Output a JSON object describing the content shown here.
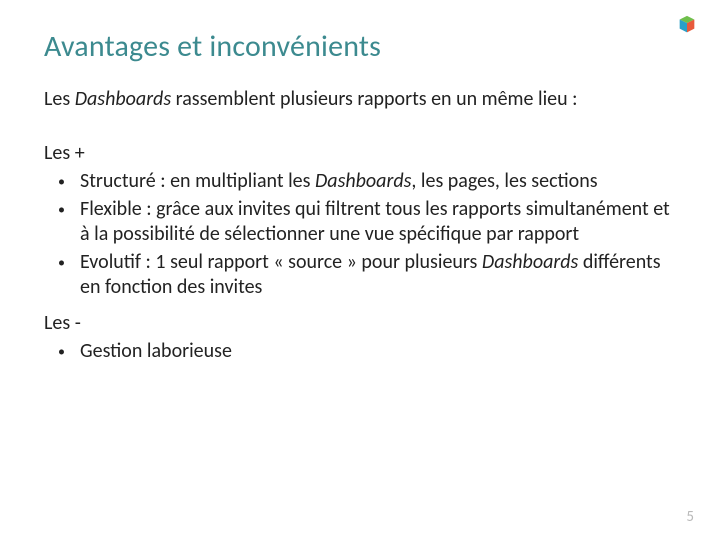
{
  "title": "Avantages et inconvénients",
  "lead_pre": "Les ",
  "lead_em": "Dashboards",
  "lead_post": " rassemblent plusieurs rapports en un même lieu :",
  "pros_label": "Les +",
  "pros": [
    {
      "html": "Structuré : en multipliant les <span class=\"term\">Dashboards</span>, les pages, les sections"
    },
    {
      "html": "Flexible : grâce aux invites qui filtrent tous les rapports simultanément et à la possibilité de sélectionner une vue spécifique par rapport"
    },
    {
      "html": "Evolutif : 1 seul rapport « source » pour plusieurs <span class=\"term\">Dashboards</span> différents en fonction des invites"
    }
  ],
  "cons_label": "Les -",
  "cons": [
    {
      "html": "Gestion laborieuse"
    }
  ],
  "page_number": "5",
  "logo_name": "cube-logo"
}
